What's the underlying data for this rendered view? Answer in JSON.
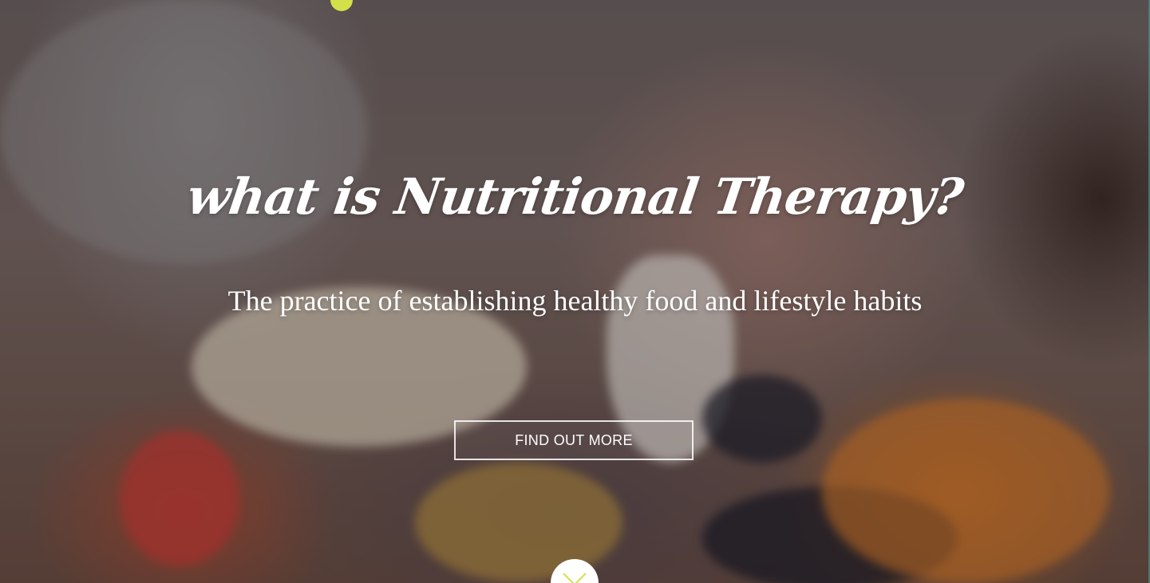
{
  "hero": {
    "title": "what is Nutritional Therapy?",
    "subtitle": "The practice of establishing healthy food and lifestyle habits",
    "cta_label": "FIND OUT MORE",
    "accent_color": "#d4e04a",
    "scroll_icon": "chevron-down-icon"
  }
}
